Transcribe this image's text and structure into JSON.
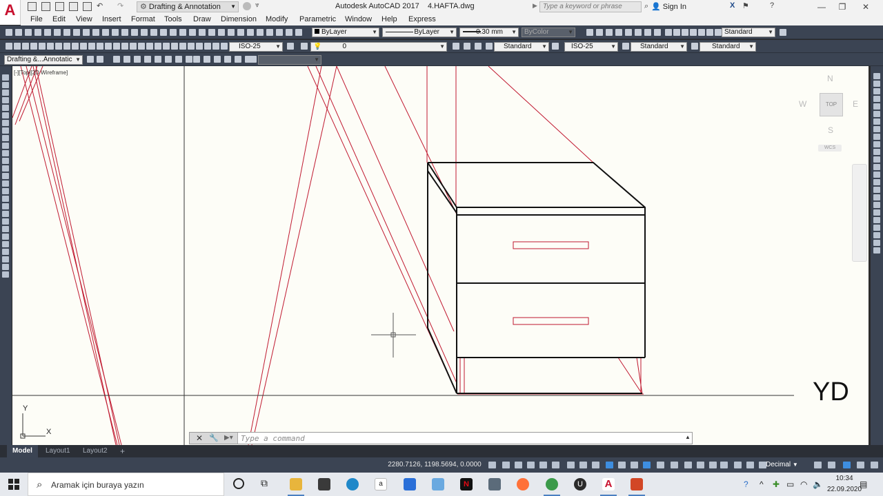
{
  "window": {
    "app_name": "Autodesk AutoCAD 2017",
    "document": "4.HAFTA.dwg",
    "logo_letter": "A",
    "workspace": "Drafting & Annotation",
    "search_placeholder": "Type a keyword or phrase",
    "sign_in": "Sign In"
  },
  "menu": [
    "File",
    "Edit",
    "View",
    "Insert",
    "Format",
    "Tools",
    "Draw",
    "Dimension",
    "Modify",
    "Parametric",
    "Window",
    "Help",
    "Express"
  ],
  "properties": {
    "color": "ByLayer",
    "linetype": "ByLayer",
    "lineweight": "0.30 mm",
    "plotstyle": "ByColor",
    "text_style": "Standard"
  },
  "dim_toolbar": {
    "dim_style": "ISO-25",
    "layer": "0",
    "text_style": "Standard",
    "dim_style2": "ISO-25",
    "table_style": "Standard",
    "multileader_style": "Standard"
  },
  "workspace_toolbar": {
    "workspace": "Drafting &...Annotatic"
  },
  "viewport": {
    "label": "[-][Top][2D Wireframe]",
    "viewcube_face": "TOP",
    "compass": {
      "n": "N",
      "s": "S",
      "e": "E",
      "w": "W"
    },
    "wcs": "WCS",
    "watermark": "YD",
    "ucs_x": "X",
    "ucs_y": "Y"
  },
  "command_line": {
    "placeholder": "Type a command"
  },
  "layout_tabs": [
    "Model",
    "Layout1",
    "Layout2"
  ],
  "layout_add": "+",
  "status": {
    "coordinates": "2280.7126, 1198.5694, 0.0000",
    "units": "Decimal"
  },
  "taskbar": {
    "search": "Aramak için buraya yazın",
    "time": "10:34",
    "date": "22.09.2020"
  },
  "colors": {
    "ribbon_dark": "#3b4453",
    "canvas": "#fdfdf7",
    "drawing_red": "#c0182f",
    "autocad_red": "#c8102e"
  }
}
